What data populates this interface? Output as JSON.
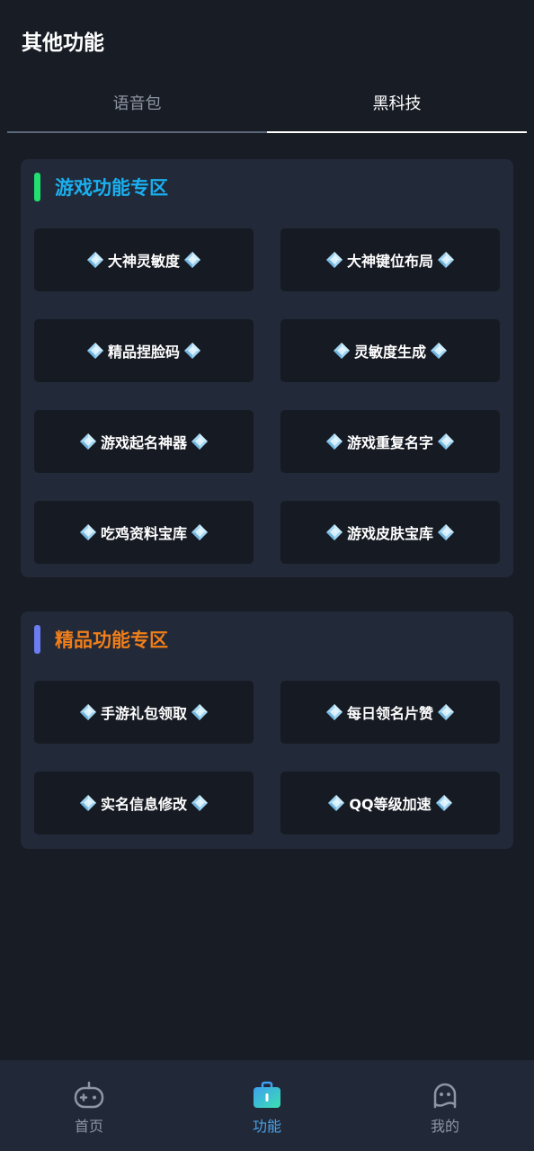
{
  "header": {
    "title": "其他功能"
  },
  "tabs": [
    {
      "label": "语音包",
      "active": false
    },
    {
      "label": "黑科技",
      "active": true
    }
  ],
  "sections": [
    {
      "title": "游戏功能专区",
      "title_color": "#1ab0f0",
      "bar_color": "#20e070",
      "items": [
        "大神灵敏度",
        "大神键位布局",
        "精品捏脸码",
        "灵敏度生成",
        "游戏起名神器",
        "游戏重复名字",
        "吃鸡资料宝库",
        "游戏皮肤宝库"
      ]
    },
    {
      "title": "精品功能专区",
      "title_color": "#f07e1a",
      "bar_color": "#6a7cf0",
      "items": [
        "手游礼包领取",
        "每日领名片赞",
        "实名信息修改",
        "QQ等级加速"
      ]
    }
  ],
  "bottom_nav": [
    {
      "label": "首页",
      "icon": "gamepad-icon",
      "active": false
    },
    {
      "label": "功能",
      "icon": "briefcase-icon",
      "active": true
    },
    {
      "label": "我的",
      "icon": "robot-face-icon",
      "active": false
    }
  ],
  "colors": {
    "background": "#181c25",
    "card": "#161a23",
    "section": "#222938",
    "nav_active": "#4aa3e6"
  }
}
